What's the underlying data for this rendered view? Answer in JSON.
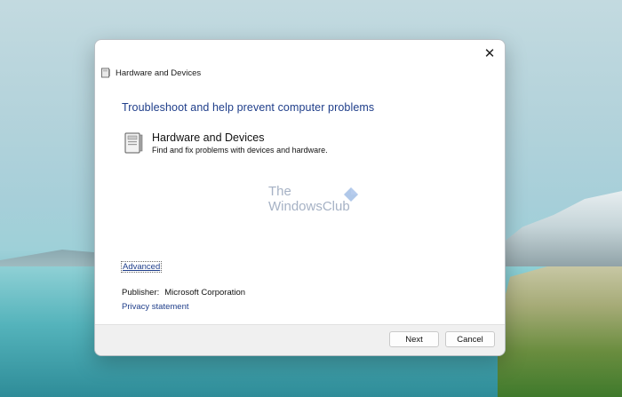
{
  "window": {
    "title": "Hardware and Devices",
    "close_glyph": "✕"
  },
  "main": {
    "heading": "Troubleshoot and help prevent computer problems",
    "tool": {
      "title": "Hardware and Devices",
      "description": "Find and fix problems with devices and hardware."
    },
    "watermark": {
      "line1": "The",
      "line2": "WindowsClub"
    },
    "advanced_link": "Advanced",
    "publisher_label": "Publisher:",
    "publisher_value": "Microsoft Corporation",
    "privacy_link": "Privacy statement"
  },
  "footer": {
    "next_label": "Next",
    "cancel_label": "Cancel"
  },
  "colors": {
    "link": "#1f3e8a",
    "heading": "#1f3e8a",
    "footer_bg": "#f0f0f0"
  }
}
